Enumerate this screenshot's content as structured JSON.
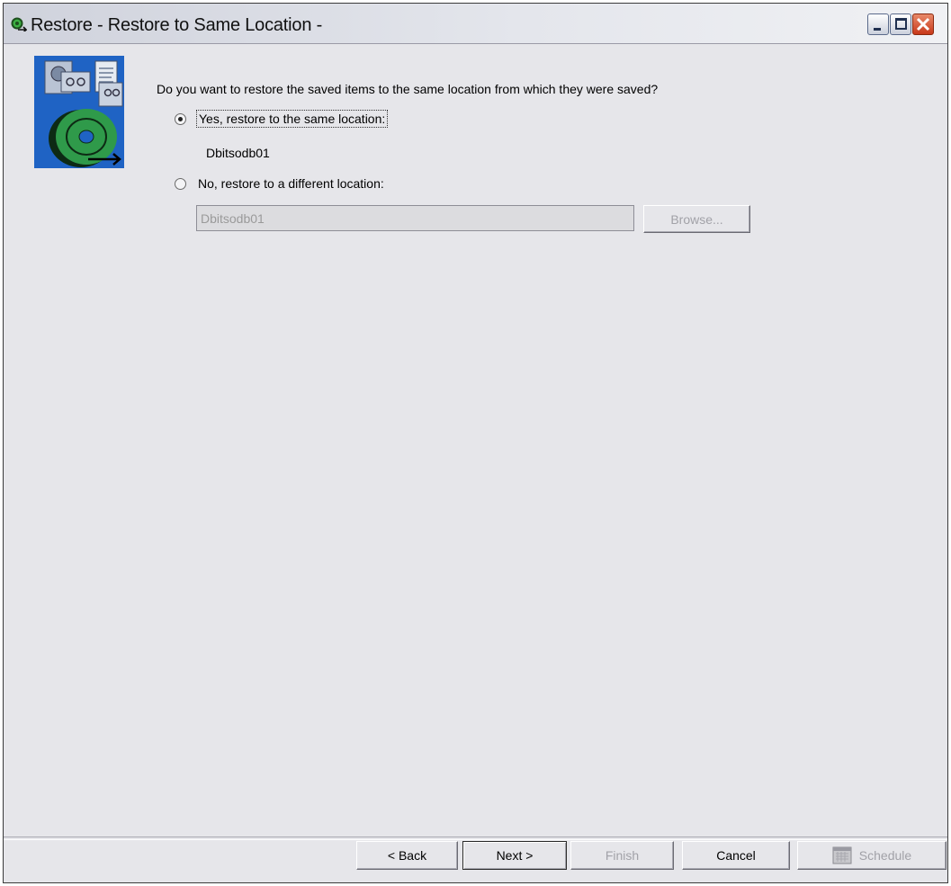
{
  "window": {
    "title": "Restore - Restore to Same Location -"
  },
  "prompt": {
    "question": "Do you want to restore the saved items to the same location from which they were saved?"
  },
  "options": {
    "same_location_label": "Yes, restore to the same location:",
    "same_location_selected": true,
    "current_location": "Dbitsodb01",
    "different_location_label": "No, restore to a different location:",
    "different_location_selected": false,
    "different_location_value": "Dbitsodb01",
    "browse_label": "Browse..."
  },
  "buttons": {
    "back": "< Back",
    "next": "Next >",
    "finish": "Finish",
    "cancel": "Cancel",
    "schedule": "Schedule"
  },
  "icons": {
    "title_icon": "restore-app-icon",
    "wizard_image": "restore-wizard-graphic",
    "schedule_icon": "calendar-icon",
    "window_controls": [
      "minimize-icon",
      "maximize-icon",
      "close-icon"
    ]
  },
  "colors": {
    "wizard_image_background": "#1f63c4",
    "disc_green": "#2f9a4a",
    "close_button": "#d9502a"
  }
}
